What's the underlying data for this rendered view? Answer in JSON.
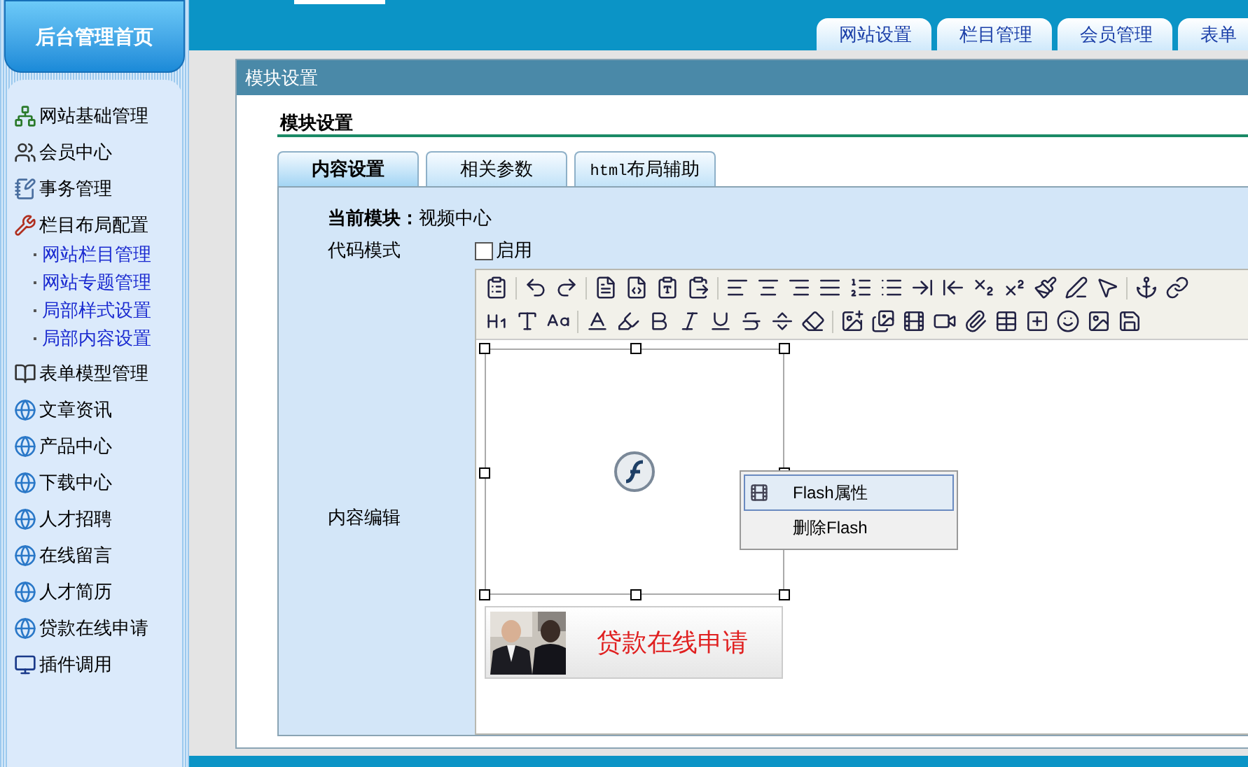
{
  "sidebar": {
    "header": "后台管理首页",
    "items": [
      {
        "label": "网站基础管理",
        "kind": "network"
      },
      {
        "label": "会员中心",
        "kind": "users"
      },
      {
        "label": "事务管理",
        "kind": "notepad"
      },
      {
        "label": "栏目布局配置",
        "kind": "tools",
        "children": [
          {
            "label": "网站栏目管理"
          },
          {
            "label": "网站专题管理"
          },
          {
            "label": "局部样式设置"
          },
          {
            "label": "局部内容设置"
          }
        ]
      },
      {
        "label": "表单模型管理",
        "kind": "book"
      },
      {
        "label": "文章资讯",
        "kind": "ie"
      },
      {
        "label": "产品中心",
        "kind": "ie"
      },
      {
        "label": "下载中心",
        "kind": "ie"
      },
      {
        "label": "人才招聘",
        "kind": "ie"
      },
      {
        "label": "在线留言",
        "kind": "ie"
      },
      {
        "label": "人才简历",
        "kind": "ie"
      },
      {
        "label": "贷款在线申请",
        "kind": "ie"
      },
      {
        "label": "插件调用",
        "kind": "computer"
      }
    ]
  },
  "top_tabs": [
    "网站设置",
    "栏目管理",
    "会员管理",
    "表单"
  ],
  "panel": {
    "title": "模块设置",
    "heading": "模块设置",
    "tabs": [
      {
        "label": "内容设置",
        "selected": true
      },
      {
        "label": "相关参数",
        "selected": false
      },
      {
        "code": "html",
        "label": "布局辅助",
        "selected": false
      }
    ],
    "current_module": {
      "label": "当前模块：",
      "value": "视频中心"
    },
    "code_mode": {
      "label": "代码模式",
      "checkbox_label": "启用",
      "checked": false
    },
    "editor": {
      "label": "内容编辑",
      "banner_text": "贷款在线申请",
      "context_menu": [
        {
          "label": "Flash属性",
          "selected": true
        },
        {
          "label": "删除Flash",
          "selected": false
        }
      ]
    }
  }
}
